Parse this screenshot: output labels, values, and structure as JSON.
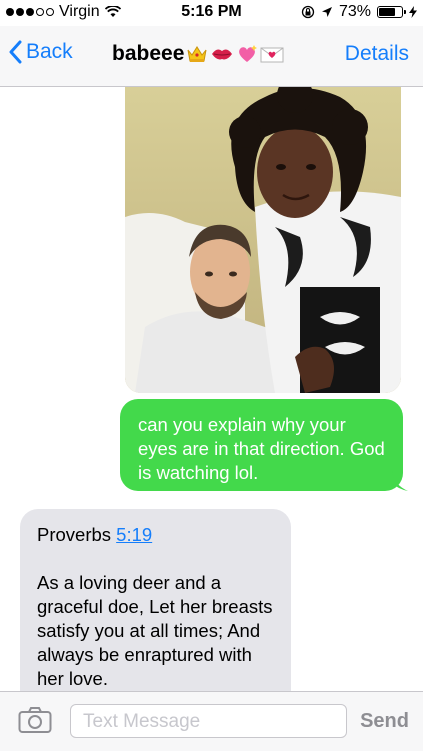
{
  "status_bar": {
    "carrier": "Virgin",
    "time": "5:16 PM",
    "battery_percent": "73%",
    "battery_level": 0.73,
    "signal_bars_filled": 3,
    "signal_bars_total": 5
  },
  "nav": {
    "back_label": "Back",
    "title": "babeee",
    "title_emojis": [
      "crown-emoji",
      "kiss-lips-emoji",
      "sparkling-heart-emoji",
      "love-letter-emoji"
    ],
    "details_label": "Details"
  },
  "conversation": {
    "photo": "selfie-couple-photo",
    "sent_message": "can you explain why your eyes are in that direction. God is watching lol.",
    "received_message": {
      "reference_prefix": "Proverbs ",
      "reference_link": "5:19",
      "body": "As a loving deer and a graceful doe, Let her breasts satisfy you at all times; And always be enraptured with her love."
    }
  },
  "input_bar": {
    "placeholder": "Text Message",
    "send_label": "Send"
  },
  "colors": {
    "accent_blue": "#157efb",
    "sent_bubble": "#43d94b",
    "received_bubble": "#e5e5ea"
  }
}
